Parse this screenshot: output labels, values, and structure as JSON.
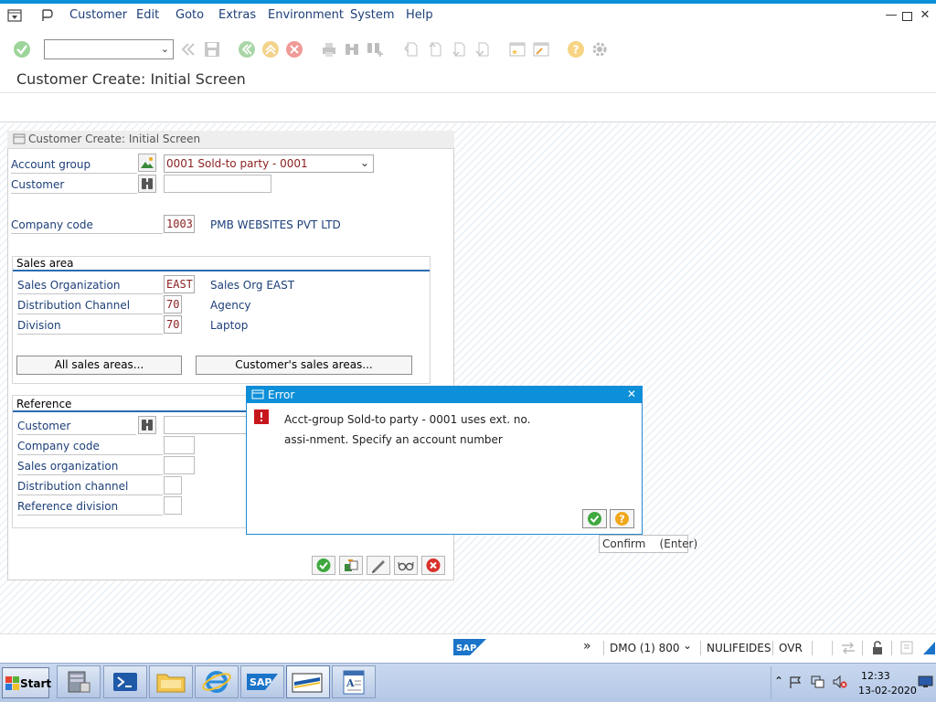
{
  "menubar": {
    "items": [
      "Customer",
      "Edit",
      "Goto",
      "Extras",
      "Environment",
      "System",
      "Help"
    ]
  },
  "title": "Customer Create: Initial Screen",
  "panel": {
    "header": "Customer Create: Initial Screen",
    "account_group_label": "Account group",
    "account_group_value": "0001 Sold-to party - 0001",
    "customer_label": "Customer",
    "customer_value": "",
    "company_code_label": "Company code",
    "company_code_value": "1003",
    "company_code_name": "PMB WEBSITES PVT LTD",
    "sales_area": {
      "title": "Sales area",
      "sales_org_label": "Sales Organization",
      "sales_org_value": "EAST",
      "sales_org_name": "Sales Org EAST",
      "dist_channel_label": "Distribution Channel",
      "dist_channel_value": "70",
      "dist_channel_name": "Agency",
      "division_label": "Division",
      "division_value": "70",
      "division_name": "Laptop",
      "all_sales_areas_btn": "All sales areas...",
      "customers_sales_areas_btn": "Customer's sales areas..."
    },
    "reference": {
      "title": "Reference",
      "customer_label": "Customer",
      "company_code_label": "Company code",
      "sales_org_label": "Sales organization",
      "dist_channel_label": "Distribution channel",
      "division_label": "Reference division"
    }
  },
  "dialog": {
    "title": "Error",
    "line1": "Acct-group Sold-to party - 0001 uses ext. no.",
    "line2": "assi-nment. Specify an account number"
  },
  "tooltip": "Confirm    (Enter)",
  "statusbar": {
    "system": "DMO (1) 800",
    "server": "NULIFEIDES",
    "mode": "OVR"
  },
  "taskbar": {
    "start_label": "Start",
    "time": "12:33",
    "date": "13-02-2020"
  },
  "colors": {
    "accent": "#0d8fd9",
    "label_blue": "#1c3f78",
    "value_red": "#8b1f1f",
    "ok_green": "#3fa83f",
    "cancel_red": "#d9312b",
    "help_orange": "#f0a81c"
  }
}
